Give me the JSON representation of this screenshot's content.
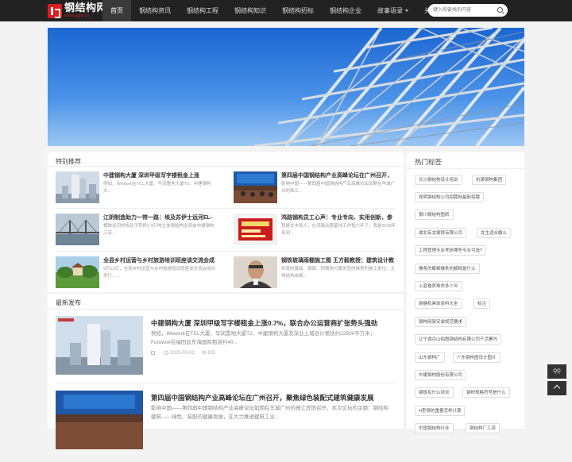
{
  "site": {
    "logo_title": "钢结构网",
    "logo_sub": "www.gjgk.cn"
  },
  "nav": {
    "items": [
      {
        "label": "首页",
        "active": true
      },
      {
        "label": "钢结构资讯"
      },
      {
        "label": "钢结构工程"
      },
      {
        "label": "钢结构知识"
      },
      {
        "label": "钢结构招标"
      },
      {
        "label": "钢结构企业"
      },
      {
        "label": "故事语录",
        "dropdown": true
      },
      {
        "label": "关于我们",
        "dropdown": true
      }
    ]
  },
  "search": {
    "placeholder": "键入你要找的内容"
  },
  "featured": {
    "title": "特别推荐",
    "items": [
      {
        "title": "中建钢构大厦 深圳甲级写字楼租金上涨",
        "desc": "例如，Wework在TCL大厦、华润置地大厦T2、中建钢构大..."
      },
      {
        "title": "第四届中国钢结构产业高峰论坛在广州召开，",
        "desc": "影响中国——第四届中国钢结构产业高峰论坛如期在羊城广州的珠江..."
      },
      {
        "title": "江阴制造助力一带一路：埃及苏伊士运河EL-",
        "desc": "横跨运河的埃及平转桥1.4万吨主体钢结构全部由中建钢构江苏..."
      },
      {
        "title": "鸿路钢构员工心声：专业专向、实用创新，参",
        "desc": "我是长丰县人，在鸿路合肥基地工作我六年了，我是2018年来到..."
      },
      {
        "title": "全县乡村运营与乡村旅游培训班座谈交流会成",
        "desc": "9月12日，全县乡村运营与乡村旅游培训班座谈交流会成功举行，..."
      },
      {
        "title": "钢铁玻璃雨棚施工图 王方毅教授：建筑设计教",
        "desc": "桥梁的基础、钢铁、附属物分属类型的跨界的施工单位：主体结构由钢..."
      }
    ]
  },
  "latest": {
    "title": "最新发布",
    "items": [
      {
        "title": "中建钢构大厦 深圳甲级写字楼租金上涨0.7%，联合办公运营商扩张势头强劲",
        "desc": "例如，Wework在TCL大厦、华润置地大厦T2、中建钢构大厦及深业上城合计租赁约22500平方米；Funwork在福田区东海国际租赁约40...",
        "date": "2025-03-02",
        "views": "105"
      },
      {
        "title": "第四届中国钢结构产业高峰论坛在广州召开，聚焦绿色装配式建筑健康发展",
        "desc": "影响中国——第四届中国钢结构产业高峰论坛如期在羊城广州的珠江宾馆召开，本次论坛的主题：钢结构建筑——绿色、装配的健康发展，在大力推进建筑工业...",
        "date": "",
        "views": ""
      }
    ]
  },
  "tags": {
    "title": "热门标签",
    "items": [
      "长沙钢结构设计培训",
      "杭萧钢构集团",
      "昆明钢结构公司招聘网最新招聘",
      "银川钢结构图纸",
      "湖北有龙钢铁有限公司",
      "女生适合搬么",
      "工程管理专业考研哪些专业可选?",
      "楼条的解释楼条的解释是什么",
      "上蓝楼房寿命多少年",
      "钢搪机具体资料大全",
      "标注",
      "钢构网架安装规范要求",
      "辽宁调兵山柏图钢结构有限公司干活累吗",
      "山东钢构厂",
      "广东钢构图设计图片",
      "中建钢构股份有限公司",
      "钢筑有什么培训",
      "钢材规格符号是什么",
      "H型钢的重量怎样计算",
      "中国钢结构行业",
      "钢结构厂工资"
    ]
  },
  "float": {
    "qq": "QQ"
  }
}
